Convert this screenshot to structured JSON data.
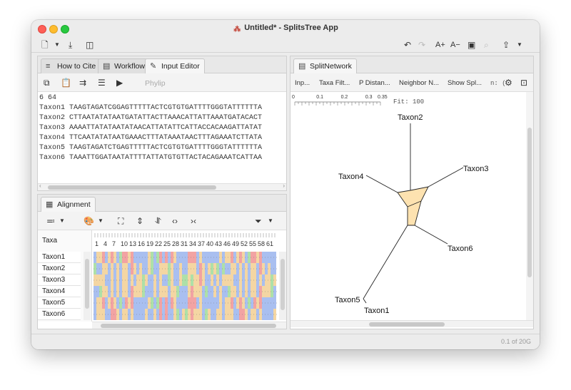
{
  "window": {
    "title": "Untitled* - SplitsTree App"
  },
  "left_top_tabs": [
    {
      "label": "How to Cite",
      "icon": "lines-icon"
    },
    {
      "label": "Workflow",
      "icon": "workflow-icon"
    },
    {
      "label": "Input Editor",
      "icon": "edit-icon"
    }
  ],
  "input_editor": {
    "phylip_label": "Phylip",
    "header_line": "6 64",
    "rows": [
      {
        "name": "Taxon1",
        "seq": "TAAGTAGATCGGAGTTTTTACTCGTGTGATTTTGGGTATTTTTTA"
      },
      {
        "name": "Taxon2",
        "seq": "CTTAATATATAATGATATTACTTAAACATTATTAAATGATACACT"
      },
      {
        "name": "Taxon3",
        "seq": "AAAATTATATAATATAACATTATATTCATTACCACAAGATTATAT"
      },
      {
        "name": "Taxon4",
        "seq": "TTCAATATATAATGAAACTTTATAAATAACTTTAGAAATCTTATA"
      },
      {
        "name": "Taxon5",
        "seq": "TAAGTAGATCTGAGTTTTTACTCGTGTGATTTTGGGTATTTTTTA"
      },
      {
        "name": "Taxon6",
        "seq": "TAAATTGGATAATATTTTATTATGTGTTACTACAGAAATCATTAA"
      }
    ]
  },
  "alignment": {
    "tab_label": "Alignment",
    "taxa_header": "Taxa",
    "taxa": [
      "Taxon1",
      "Taxon2",
      "Taxon3",
      "Taxon4",
      "Taxon5",
      "Taxon6"
    ],
    "column_ticks": [
      "1",
      "4",
      "7",
      "10",
      "13",
      "16",
      "19",
      "22",
      "25",
      "28",
      "31",
      "34",
      "37",
      "40",
      "43",
      "46",
      "49",
      "52",
      "55",
      "58",
      "61"
    ],
    "colors": {
      "A": "#f4d6a3",
      "C": "#aee0a8",
      "G": "#f2a3a3",
      "T": "#a9bff0"
    }
  },
  "network": {
    "tab_label": "SplitNetwork",
    "toolbar": [
      "Inp...",
      "Taxa Filt...",
      "P Distan...",
      "Neighbor N...",
      "Show Spl..."
    ],
    "toolbar_extra": "n: (",
    "scale": {
      "ticks": [
        "0",
        "0.1",
        "0.2",
        "0.3",
        "0.35"
      ],
      "fit_label": "Fit: 100"
    },
    "taxa_labels": [
      "Taxon2",
      "Taxon3",
      "Taxon4",
      "Taxon6",
      "Taxon5",
      "Taxon1"
    ],
    "box_color": "#fde2b0"
  },
  "status": {
    "memory": "0.1 of 20G"
  }
}
